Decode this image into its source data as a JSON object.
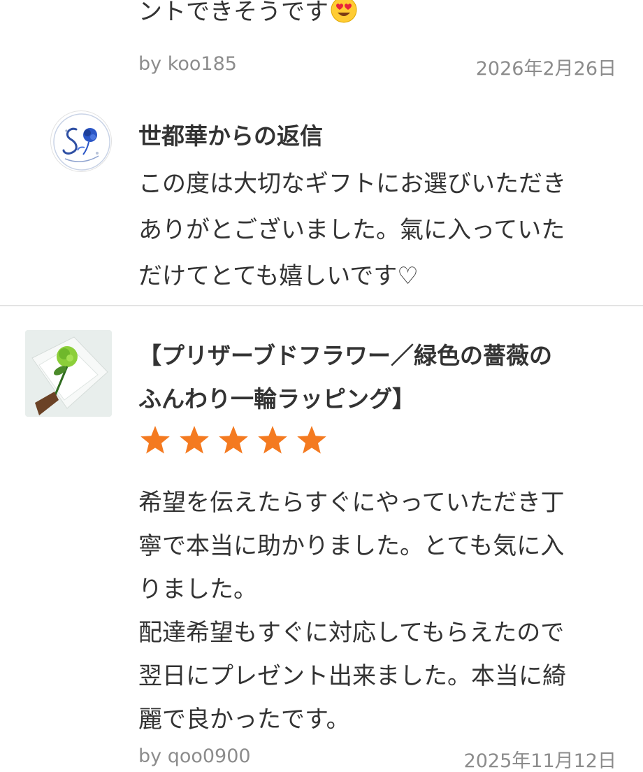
{
  "previous_review": {
    "text_tail": "ントできそうです",
    "emoji": "heart-eyes-emoji",
    "author": "by koo185",
    "date": "2026年2月26日"
  },
  "shop_reply": {
    "avatar_icon": "blue-rose-logo-icon",
    "title": "世都華からの返信",
    "body_lines": [
      "この度は大切なギフトにお選びいただき",
      "ありがとございました。氣に入っていた",
      "だけてとても嬉しいです♡"
    ]
  },
  "review": {
    "product_image": "green-rose-bouquet-thumbnail",
    "title_lines": [
      "【プリザーブドフラワー／緑色の薔薇の",
      "ふんわり一輪ラッピング】"
    ],
    "rating": 5,
    "rating_max": 5,
    "star_color": "#f47a20",
    "body_lines": [
      "希望を伝えたらすぐにやっていただき丁",
      "寧で本当に助かりました。とても気に入",
      "りました。",
      "配達希望もすぐに対応してもらえたので",
      "翌日にプレゼント出来ました。本当に綺",
      "麗で良かったです。"
    ],
    "author": "by qoo0900",
    "date": "2025年11月12日"
  }
}
